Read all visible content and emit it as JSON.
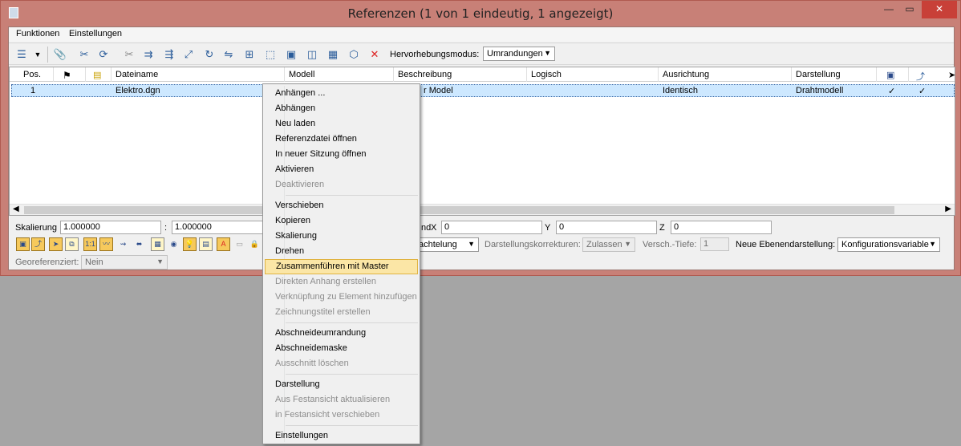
{
  "window": {
    "title": "Referenzen (1 von 1 eindeutig, 1 angezeigt)",
    "min_glyph": "—",
    "max_glyph": "▭",
    "close_glyph": "✕"
  },
  "menubar": {
    "items": [
      "Funktionen",
      "Einstellungen"
    ]
  },
  "toolbar": {
    "highlight_label": "Hervorhebungsmodus:",
    "highlight_value": "Umrandungen"
  },
  "table": {
    "columns": [
      "Pos.",
      "",
      "",
      "Dateiname",
      "Modell",
      "Beschreibung",
      "Logisch",
      "Ausrichtung",
      "Darstellung"
    ],
    "rows": [
      {
        "pos": "1",
        "file": "Elektro.dgn",
        "desc": "r Model",
        "align": "Identisch",
        "display": "Drahtmodell",
        "check1": "✓",
        "check2": "✓"
      }
    ]
  },
  "props": {
    "scale_label": "Skalierung",
    "scale_value": "1.000000",
    "scale_colon": ":",
    "scale_value2": "1.000000",
    "x_prefix": "nd",
    "x_label": "X",
    "x_value": "0",
    "y_label": "Y",
    "y_value": "0",
    "z_label": "Z",
    "z_value": "0",
    "nesting_value": "achtelung",
    "corr_label": "Darstellungskorrekturen:",
    "corr_value": "Zulassen",
    "depth_label": "Versch.-Tiefe:",
    "depth_value": "1",
    "newlevel_label": "Neue Ebenendarstellung:",
    "newlevel_value": "Konfigurationsvariable",
    "geo_label": "Georeferenziert:",
    "geo_value": "Nein"
  },
  "context_menu": {
    "groups": [
      [
        {
          "label": "Anhängen ...",
          "enabled": true
        },
        {
          "label": "Abhängen",
          "enabled": true
        },
        {
          "label": "Neu laden",
          "enabled": true
        },
        {
          "label": "Referenzdatei öffnen",
          "enabled": true
        },
        {
          "label": "In neuer Sitzung öffnen",
          "enabled": true
        },
        {
          "label": "Aktivieren",
          "enabled": true
        },
        {
          "label": "Deaktivieren",
          "enabled": false
        }
      ],
      [
        {
          "label": "Verschieben",
          "enabled": true
        },
        {
          "label": "Kopieren",
          "enabled": true
        },
        {
          "label": "Skalierung",
          "enabled": true
        },
        {
          "label": "Drehen",
          "enabled": true
        },
        {
          "label": "Zusammenführen mit Master",
          "enabled": true,
          "highlighted": true
        },
        {
          "label": "Direkten Anhang erstellen",
          "enabled": false
        },
        {
          "label": "Verknüpfung zu Element hinzufügen",
          "enabled": false
        },
        {
          "label": "Zeichnungstitel erstellen",
          "enabled": false
        }
      ],
      [
        {
          "label": "Abschneideumrandung",
          "enabled": true
        },
        {
          "label": "Abschneidemaske",
          "enabled": true
        },
        {
          "label": "Ausschnitt löschen",
          "enabled": false
        }
      ],
      [
        {
          "label": "Darstellung",
          "enabled": true
        },
        {
          "label": "Aus Festansicht aktualisieren",
          "enabled": false
        },
        {
          "label": "in Festansicht verschieben",
          "enabled": false
        }
      ],
      [
        {
          "label": "Einstellungen",
          "enabled": true
        }
      ]
    ]
  },
  "colors": {
    "titlebar": "#c88077",
    "close_button": "#c84038",
    "selection": "#cde8ff",
    "menu_highlight": "#fbe6a6"
  }
}
